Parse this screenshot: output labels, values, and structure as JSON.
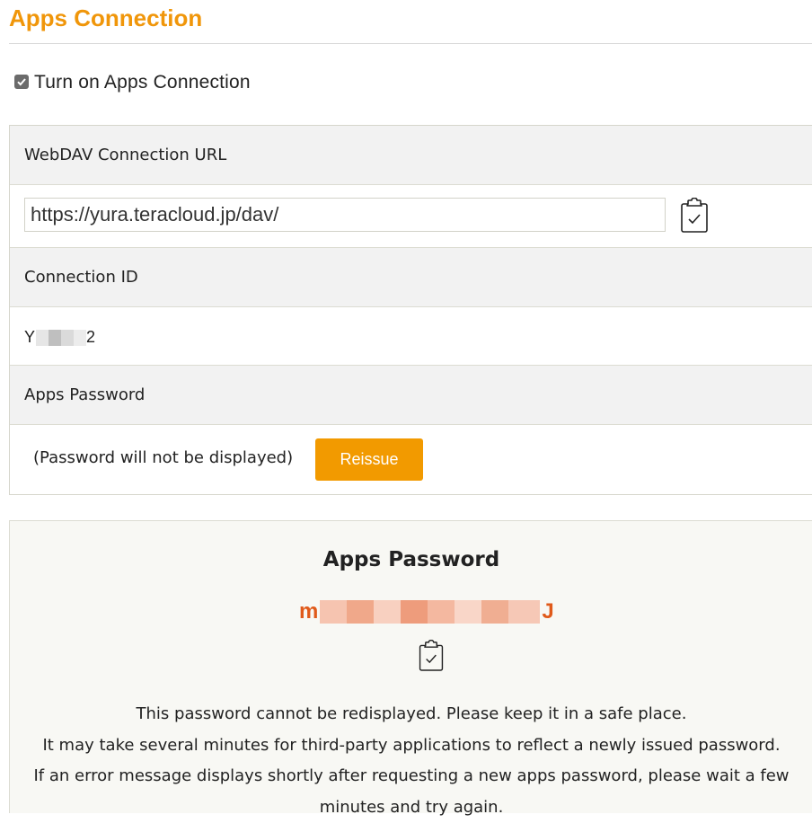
{
  "page": {
    "title": "Apps Connection"
  },
  "toggle": {
    "label": "Turn on Apps Connection",
    "checked": true
  },
  "webdav": {
    "heading": "WebDAV Connection URL",
    "url_value": "https://yura.teracloud.jp/dav/",
    "copy_icon": "clipboard-check-icon"
  },
  "connection": {
    "heading": "Connection ID",
    "id_prefix": "Y",
    "id_suffix": "2"
  },
  "apps_password": {
    "heading": "Apps Password",
    "note": "(Password will not be displayed)",
    "reissue_label": "Reissue"
  },
  "issued": {
    "title": "Apps Password",
    "password_prefix": "m",
    "password_suffix": "J",
    "copy_icon": "clipboard-check-icon",
    "notes": [
      "This password cannot be redisplayed. Please keep it in a safe place.",
      "It may take several minutes for third-party applications to reflect a newly issued password.",
      "If an error message displays shortly after requesting a new apps password, please wait a few",
      "minutes and try again."
    ]
  },
  "colors": {
    "accent": "#f0960a",
    "button": "#f29a00",
    "password": "#e05a1a"
  }
}
